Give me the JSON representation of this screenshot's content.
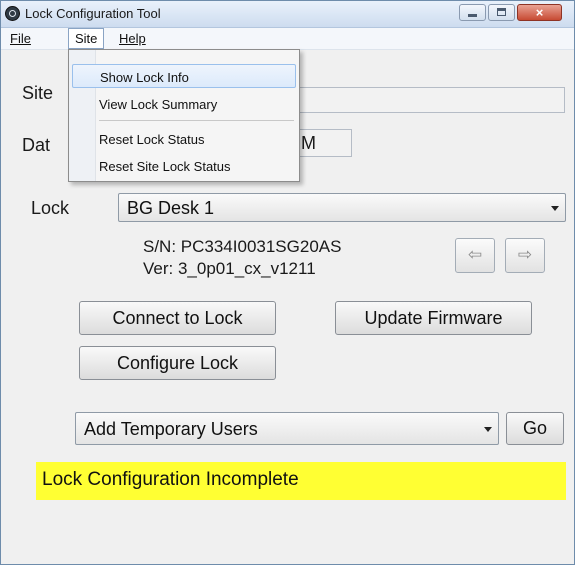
{
  "window": {
    "title": "Lock Configuration Tool",
    "close_glyph": "×"
  },
  "menubar": {
    "file": "File",
    "site": "Site",
    "help": "Help"
  },
  "site_menu": {
    "items": [
      "Show Lock Info",
      "View Lock Summary",
      "Reset Lock Status",
      "Reset Site Lock Status"
    ],
    "highlighted": "Show Lock Info"
  },
  "form": {
    "site_label": "Site",
    "date_label": "Dat",
    "date_value_partial": "M",
    "lock_label": "Lock",
    "lock_selected": "BG Desk 1",
    "serial": "S/N:  PC334I0031SG20AS",
    "version": "Ver:  3_0p01_cx_v1211",
    "prev_icon": "left-arrow-icon",
    "next_icon": "right-arrow-icon"
  },
  "buttons": {
    "connect": "Connect to Lock",
    "update": "Update Firmware",
    "configure": "Configure Lock",
    "go": "Go"
  },
  "action": {
    "selected": "Add Temporary Users"
  },
  "status": {
    "text": "Lock Configuration Incomplete",
    "color": "#ffff33"
  }
}
